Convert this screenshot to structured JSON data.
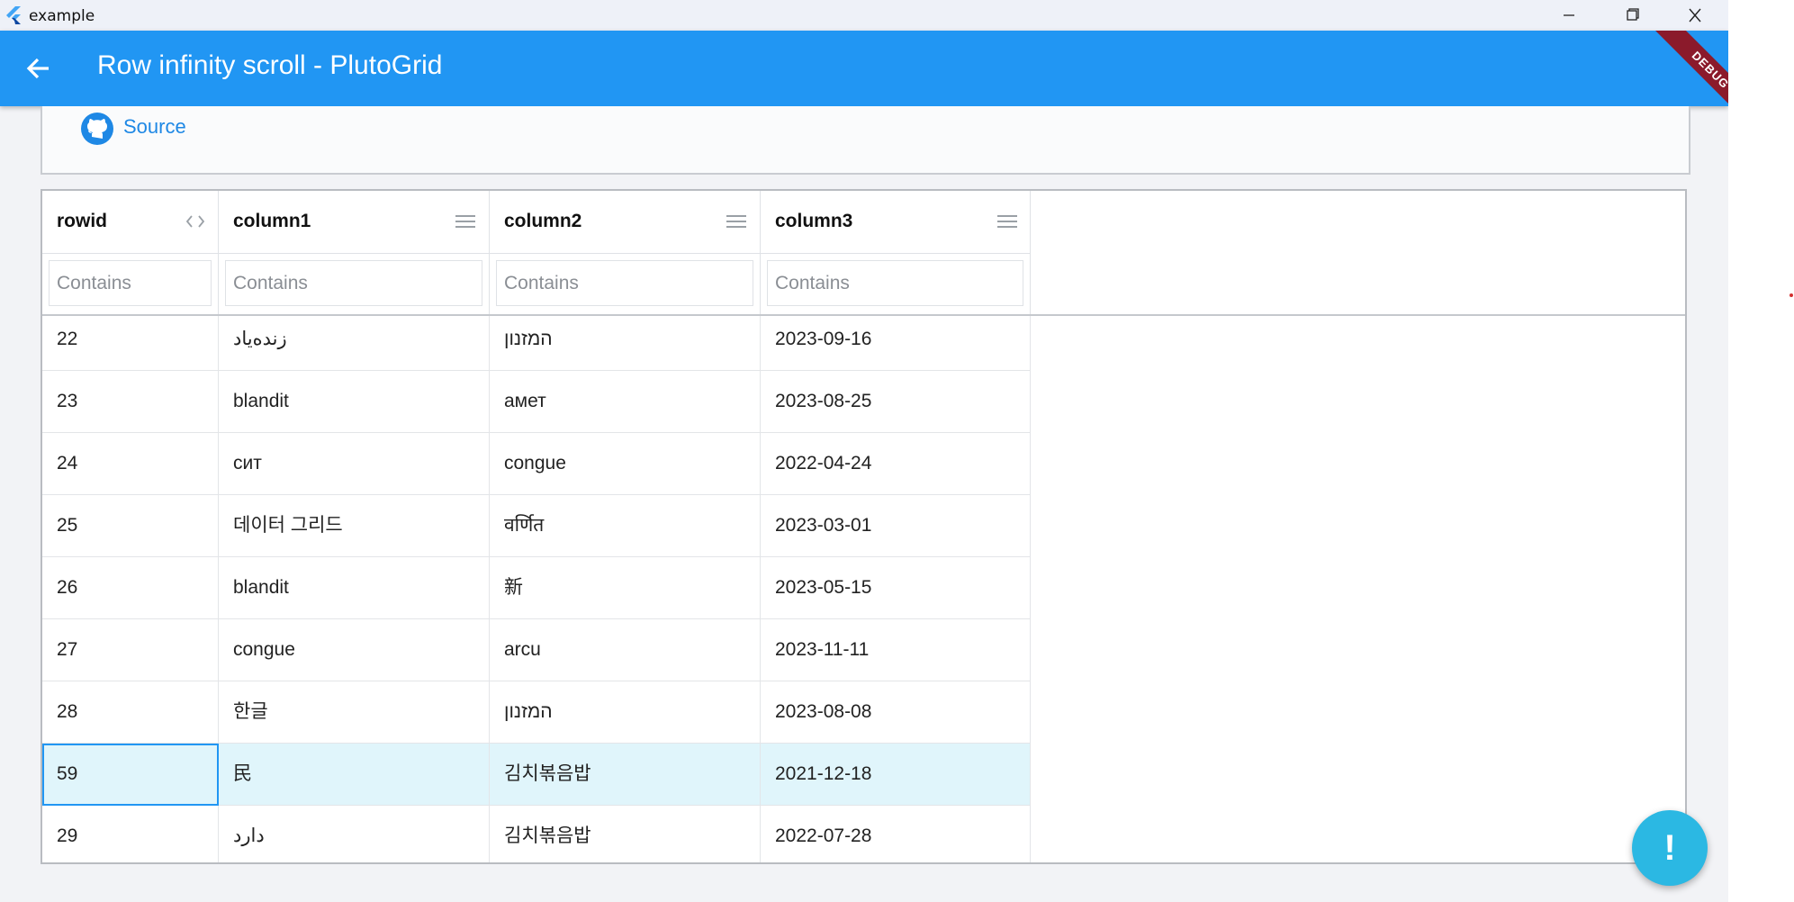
{
  "window": {
    "title": "example"
  },
  "appbar": {
    "title": "Row infinity scroll - PlutoGrid",
    "debug_label": "DEBUG"
  },
  "source": {
    "label": "Source"
  },
  "grid": {
    "columns": [
      {
        "title": "rowid",
        "filter_placeholder": "Contains"
      },
      {
        "title": "column1",
        "filter_placeholder": "Contains"
      },
      {
        "title": "column2",
        "filter_placeholder": "Contains"
      },
      {
        "title": "column3",
        "filter_placeholder": "Contains"
      }
    ],
    "rows": [
      [
        "22",
        "زنده‌یاد",
        "המזנון",
        "2023-09-16"
      ],
      [
        "23",
        "blandit",
        "амет",
        "2023-08-25"
      ],
      [
        "24",
        "сит",
        "congue",
        "2022-04-24"
      ],
      [
        "25",
        "데이터 그리드",
        "वर्णित",
        "2023-03-01"
      ],
      [
        "26",
        "blandit",
        "新",
        "2023-05-15"
      ],
      [
        "27",
        "congue",
        "arcu",
        "2023-11-11"
      ],
      [
        "28",
        "한글",
        "המזנון",
        "2023-08-08"
      ],
      [
        "59",
        "民",
        "김치볶음밥",
        "2021-12-18"
      ],
      [
        "29",
        "دارد",
        "김치볶음밥",
        "2022-07-28"
      ]
    ],
    "selected_row_index": 7
  },
  "fab": {
    "label": "!"
  },
  "colors": {
    "primary": "#2196f3",
    "selected_row": "#e0f5fb",
    "fab": "#2bb8e3",
    "debug": "#8b1a2b"
  }
}
